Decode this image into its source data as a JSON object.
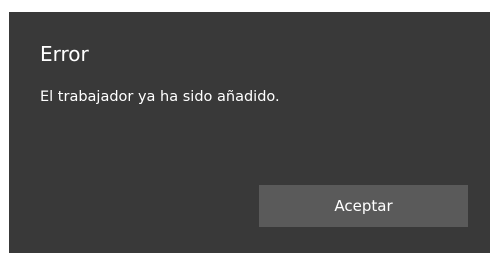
{
  "dialog": {
    "title": "Error",
    "message": "El trabajador ya ha sido añadido.",
    "ok_label": "Aceptar"
  },
  "colors": {
    "dialog_background": "#393939",
    "button_background": "#5a5a5a",
    "text": "#ffffff"
  }
}
